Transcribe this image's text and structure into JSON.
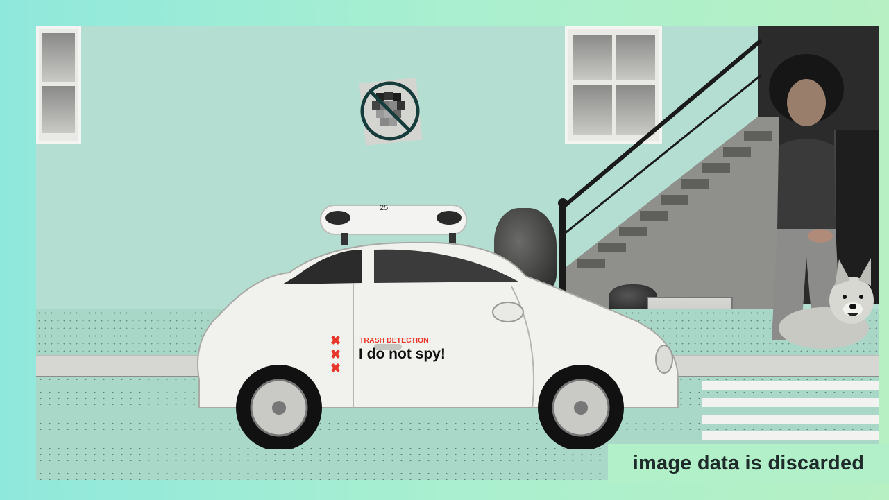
{
  "car": {
    "small_label": "TRASH DETECTION",
    "slogan": "I do not spy!",
    "marks": [
      "✖",
      "✖",
      "✖"
    ],
    "sensor_number": "25",
    "accent_color": "#e8372a"
  },
  "caption": "image data is discarded",
  "icons": {
    "no_face": "prohibited-face-icon"
  }
}
